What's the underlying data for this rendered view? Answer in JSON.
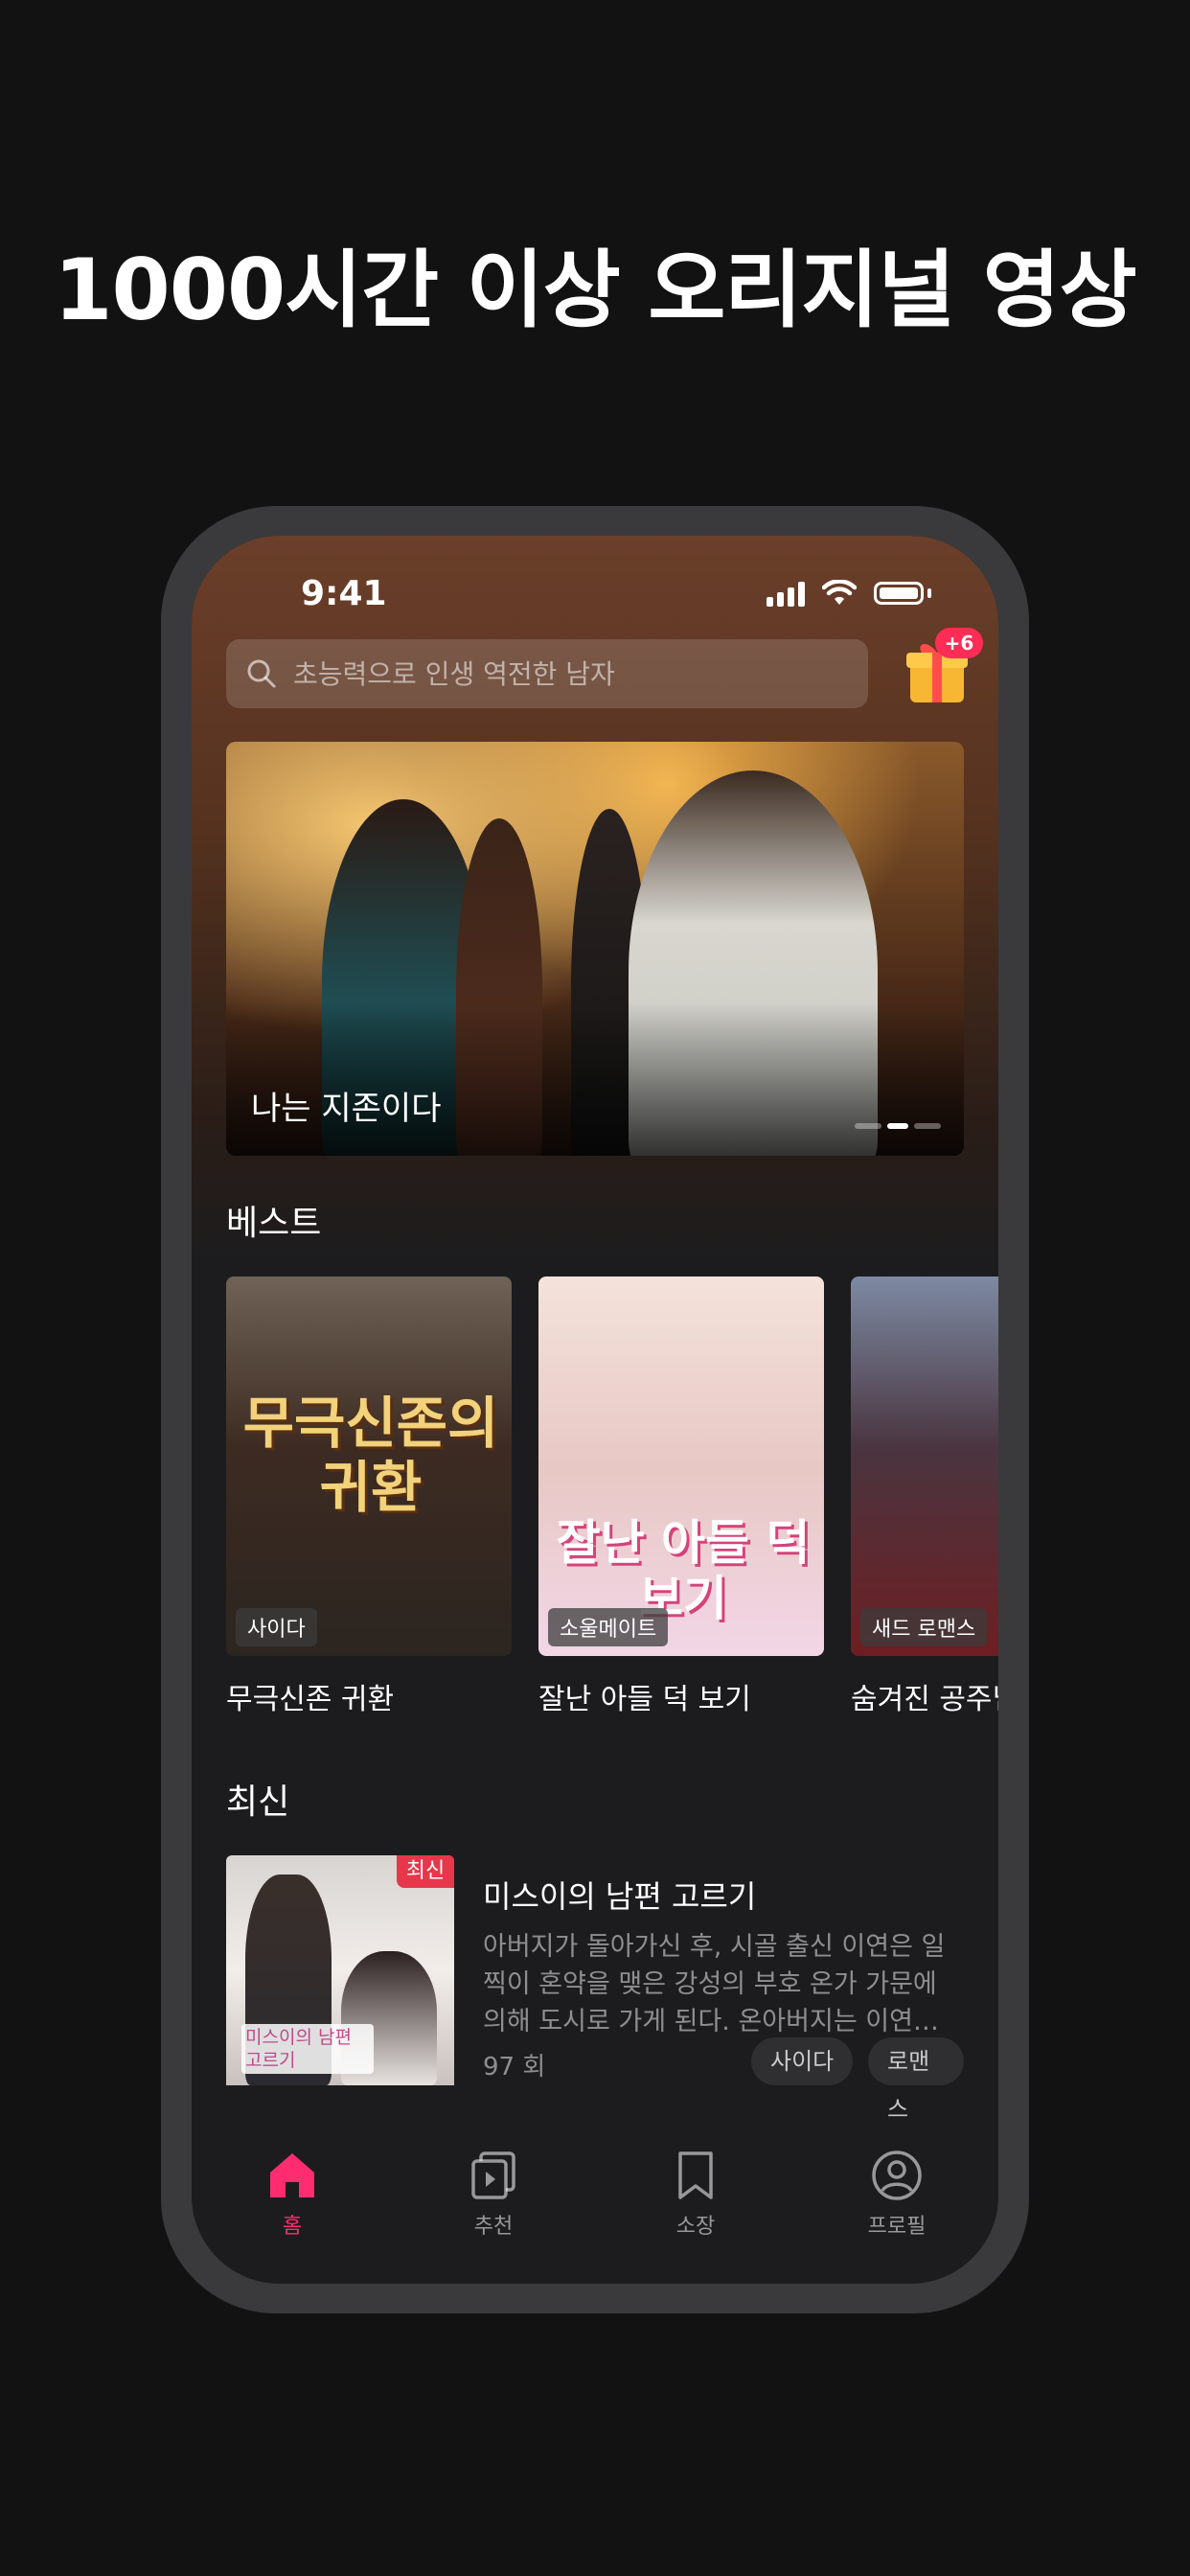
{
  "headline": "1000시간 이상 오리지널 영상",
  "status_bar": {
    "time": "9:41"
  },
  "search": {
    "placeholder": "초능력으로 인생 역전한 남자"
  },
  "gift": {
    "badge": "+6"
  },
  "banner": {
    "title": "나는 지존이다"
  },
  "best": {
    "title": "베스트",
    "items": [
      {
        "title": "무극신존 귀환",
        "tag": "사이다",
        "poster_text": "무극신존의 귀환"
      },
      {
        "title": "잘난 아들 덕 보기",
        "tag": "소울메이트",
        "poster_text": "잘난 아들 덕 보기"
      },
      {
        "title": "숨겨진 공주님",
        "tag": "새드 로맨스"
      }
    ]
  },
  "latest": {
    "title": "최신",
    "item": {
      "badge": "최신",
      "title": "미스이의 남편 고르기",
      "description": "아버지가 돌아가신 후, 시골 출신 이연은 일찍이 혼약을 맺은 강성의 부호 온가 가문에 의해 도시로 가게 된다. 온아버지는 이연…",
      "episodes": "97 회",
      "tags": [
        "사이다",
        "로맨스"
      ],
      "poster_text": "미스이의 남편 고르기"
    }
  },
  "tabs": [
    {
      "label": "홈",
      "icon": "home-icon",
      "active": true
    },
    {
      "label": "추천",
      "icon": "play-cards-icon",
      "active": false
    },
    {
      "label": "소장",
      "icon": "bookmark-icon",
      "active": false
    },
    {
      "label": "프로필",
      "icon": "profile-icon",
      "active": false
    }
  ],
  "colors": {
    "accent": "#ff2d6f",
    "badge": "#e6374b",
    "background": "#121212"
  }
}
